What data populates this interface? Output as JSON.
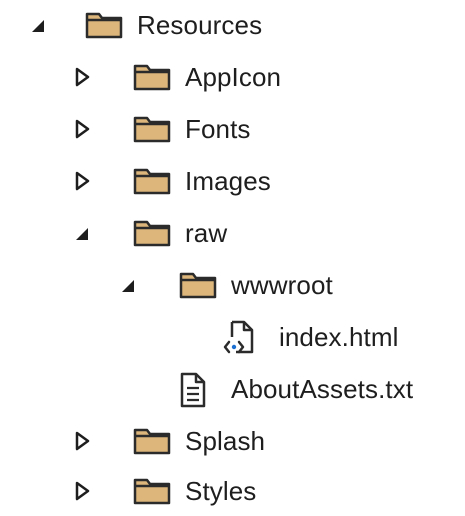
{
  "tree": {
    "resources": {
      "label": "Resources",
      "expanded": true
    },
    "appicon": {
      "label": "AppIcon",
      "expanded": false
    },
    "fonts": {
      "label": "Fonts",
      "expanded": false
    },
    "images": {
      "label": "Images",
      "expanded": false
    },
    "raw": {
      "label": "raw",
      "expanded": true
    },
    "wwwroot": {
      "label": "wwwroot",
      "expanded": true
    },
    "index_html": {
      "label": "index.html"
    },
    "about_assets": {
      "label": "AboutAssets.txt"
    },
    "splash": {
      "label": "Splash",
      "expanded": false
    },
    "styles": {
      "label": "Styles",
      "expanded": false
    }
  },
  "colors": {
    "folder_fill": "#dcb67a",
    "folder_stroke": "#2b2b2b",
    "text": "#1e1e1e",
    "chevron": "#1e1e1e",
    "file_accent": "#1b6fd1"
  },
  "icons": {
    "expanded": "triangle-down-right-icon",
    "collapsed": "triangle-right-outline-icon",
    "folder": "folder-icon",
    "html_file": "html-file-icon",
    "text_file": "text-file-icon"
  }
}
